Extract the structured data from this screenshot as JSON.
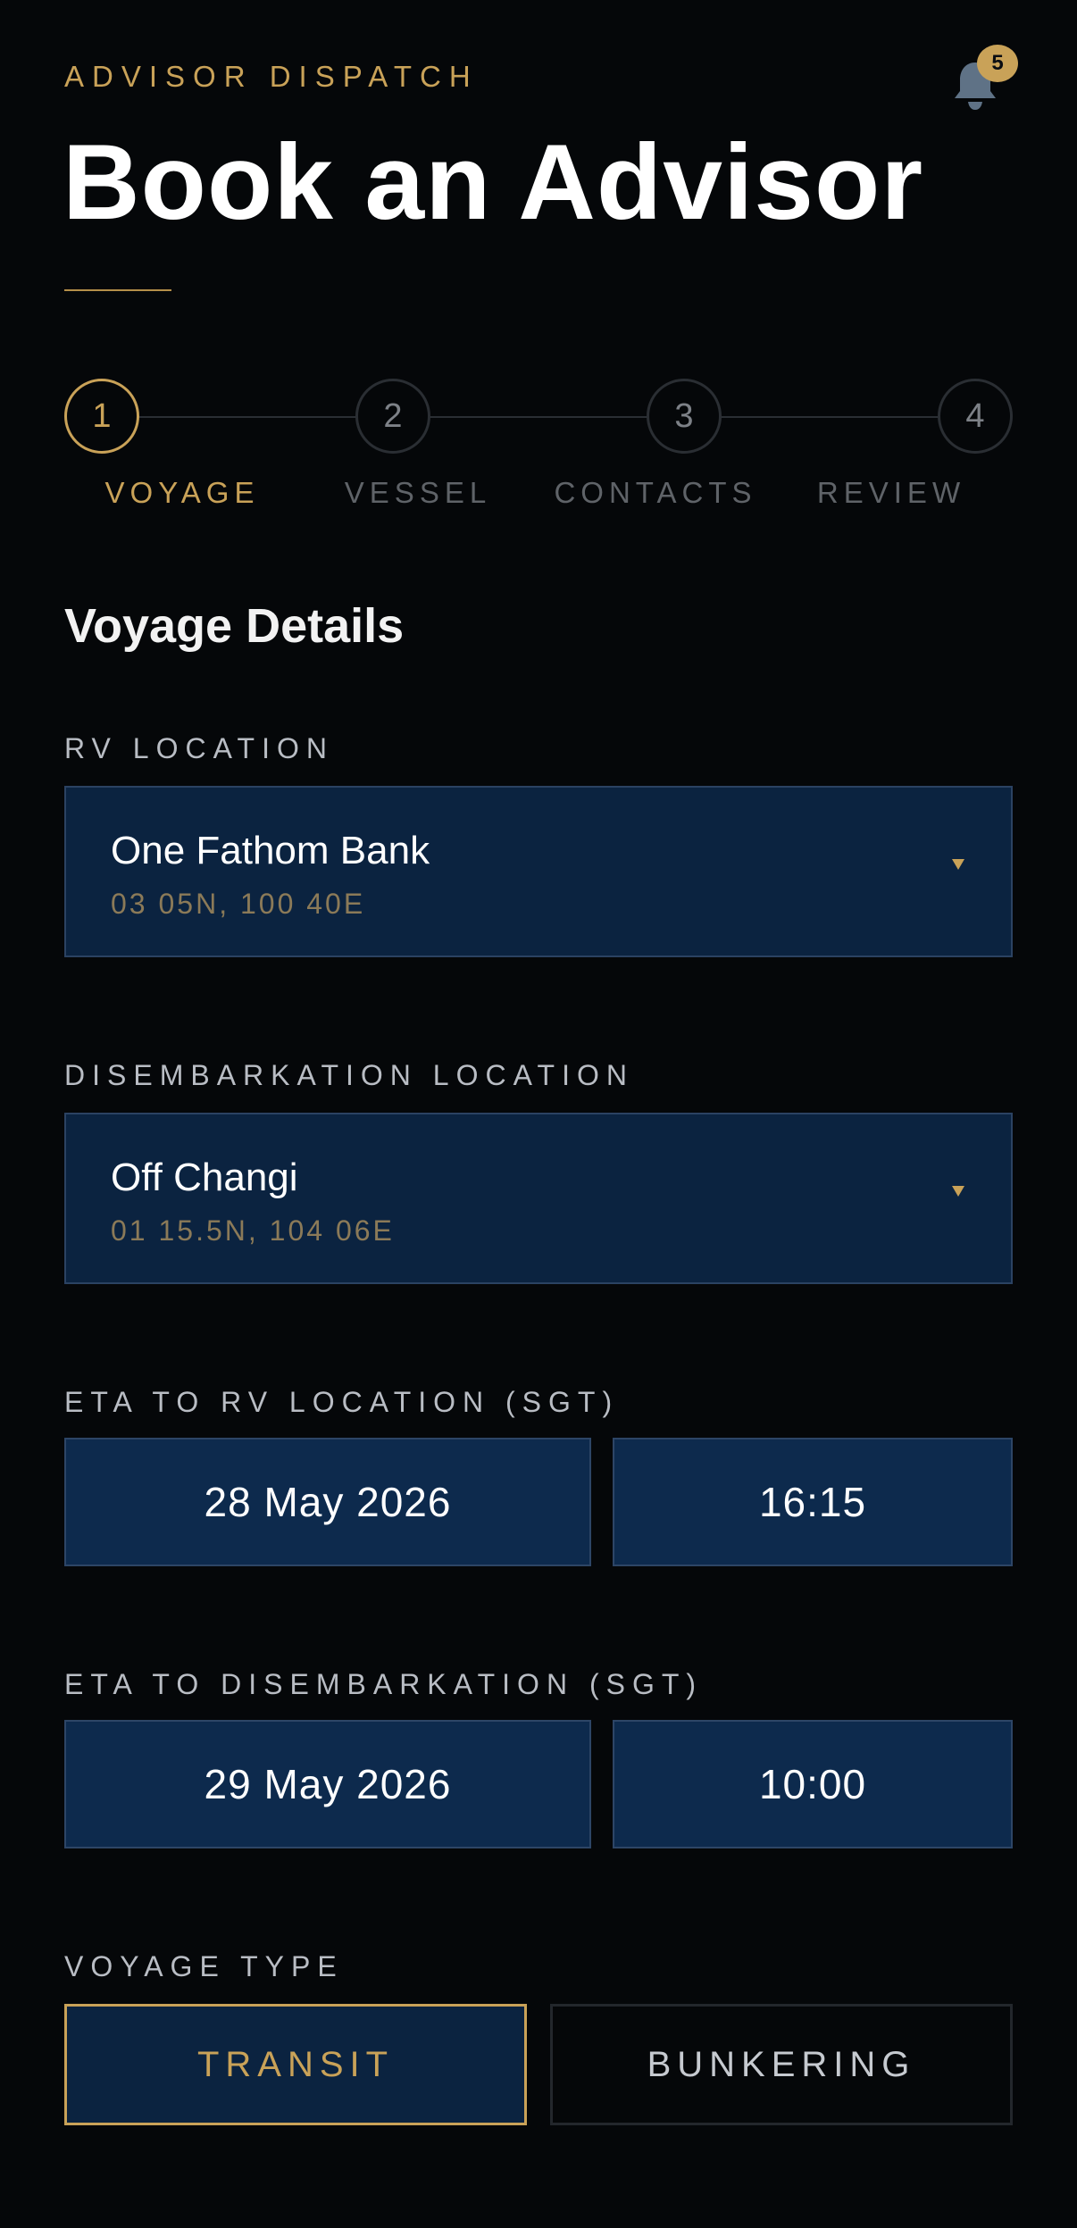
{
  "header": {
    "eyebrow": "ADVISOR DISPATCH",
    "title": "Book an Advisor",
    "notifications": {
      "icon": "bell-icon",
      "count": "5"
    }
  },
  "stepper": {
    "steps": [
      {
        "number": "1",
        "label": "VOYAGE",
        "active": true
      },
      {
        "number": "2",
        "label": "VESSEL",
        "active": false
      },
      {
        "number": "3",
        "label": "CONTACTS",
        "active": false
      },
      {
        "number": "4",
        "label": "REVIEW",
        "active": false
      }
    ]
  },
  "section": {
    "title": "Voyage Details"
  },
  "rv_location": {
    "label": "RV LOCATION",
    "name": "One Fathom Bank",
    "coords": "03 05N, 100 40E",
    "icon": "chevron-down-icon"
  },
  "disembarkation_location": {
    "label": "DISEMBARKATION LOCATION",
    "name": "Off Changi",
    "coords": "01 15.5N, 104 06E",
    "icon": "chevron-down-icon"
  },
  "eta_rv": {
    "label": "ETA TO RV LOCATION (SGT)",
    "date": "28 May 2026",
    "time": "16:15"
  },
  "eta_disembarkation": {
    "label": "ETA TO DISEMBARKATION (SGT)",
    "date": "29 May 2026",
    "time": "10:00"
  },
  "voyage_type": {
    "label": "VOYAGE TYPE",
    "options": [
      {
        "label": "TRANSIT",
        "selected": true
      },
      {
        "label": "BUNKERING",
        "selected": false
      }
    ]
  },
  "colors": {
    "background": "#050709",
    "accent_gold": "#c9a258",
    "field_navy": "#0b2340",
    "field_border": "#2b4262",
    "muted_text": "#5f6368"
  }
}
